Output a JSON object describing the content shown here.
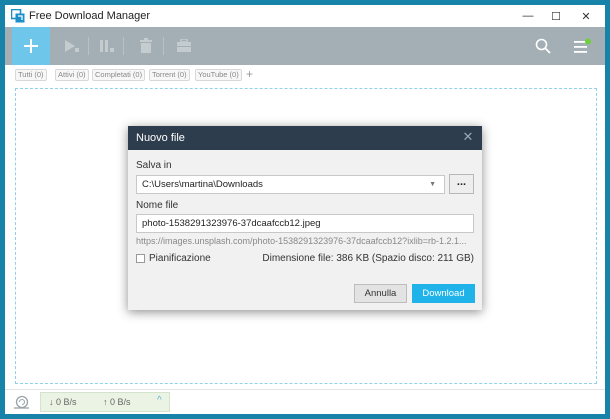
{
  "window": {
    "title": "Free Download Manager",
    "controls": {
      "minimize": "—",
      "maximize": "☐",
      "close": "✕"
    }
  },
  "toolbar": {
    "icons": [
      "add-icon",
      "play-icon",
      "pause-icon",
      "trash-icon",
      "briefcase-icon",
      "search-icon",
      "menu-icon"
    ]
  },
  "filters": {
    "tabs": [
      {
        "label": "Tutti (0)"
      },
      {
        "label": "Attivi (0)"
      },
      {
        "label": "Completati (0)"
      },
      {
        "label": "Torrent (0)"
      },
      {
        "label": "YouTube (0)"
      }
    ],
    "add": "+"
  },
  "statusbar": {
    "download_speed": "↓  0 B/s",
    "upload_speed": "↑  0 B/s",
    "expand": "^"
  },
  "dialog": {
    "title": "Nuovo file",
    "close": "✕",
    "save_in_label": "Salva in",
    "save_path": "C:\\Users\\martina\\Downloads",
    "browse_label": "...",
    "filename_label": "Nome file",
    "filename": "photo-1538291323976-37dcaafccb12.jpeg",
    "url": "https://images.unsplash.com/photo-1538291323976-37dcaafccb12?ixlib=rb-1.2.1...",
    "schedule_label": "Pianificazione",
    "file_size": "Dimensione file: 386 KB (Spazio disco: 211 GB)",
    "cancel_label": "Annulla",
    "download_label": "Download"
  },
  "colors": {
    "accent": "#1fb3ea",
    "toolbar": "#a3afb5",
    "dialog_header": "#2e3d4e",
    "desktop": "#1883a8"
  }
}
